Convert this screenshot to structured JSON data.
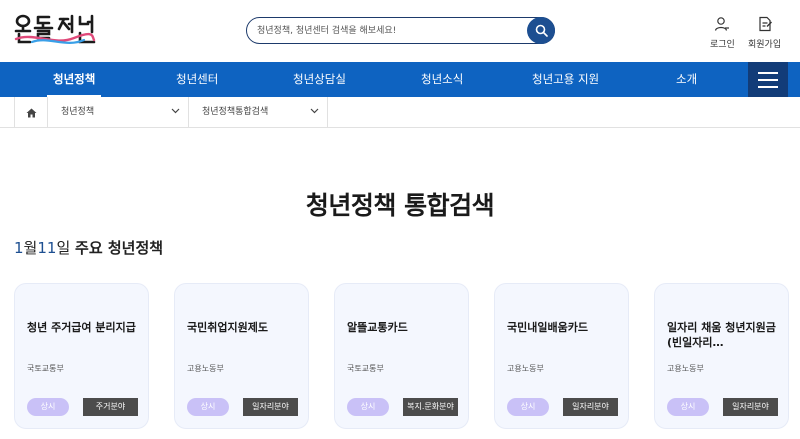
{
  "header": {
    "logo_alt": "온통청년",
    "search_placeholder": "청년정책, 청년센터 검색을 해보세요!",
    "login_label": "로그인",
    "join_label": "회원가입"
  },
  "nav": {
    "items": [
      "청년정책",
      "청년센터",
      "청년상담실",
      "청년소식",
      "청년고용 지원",
      "소개"
    ],
    "active_index": 0
  },
  "breadcrumb": {
    "level1": "청년정책",
    "level2": "청년정책통합검색"
  },
  "main": {
    "title": "청년정책 통합검색",
    "date_month": "1",
    "date_month_suffix": "월",
    "date_day": "11",
    "date_day_suffix": "일",
    "date_heading": "주요 청년정책"
  },
  "cards": [
    {
      "title": "청년 주거급여 분리지급",
      "org": "국토교통부",
      "period": "상시",
      "category": "주거분야"
    },
    {
      "title": "국민취업지원제도",
      "org": "고용노동부",
      "period": "상시",
      "category": "일자리분야"
    },
    {
      "title": "알뜰교통카드",
      "org": "국토교통부",
      "period": "상시",
      "category": "복지.문화분야"
    },
    {
      "title": "국민내일배움카드",
      "org": "고용노동부",
      "period": "상시",
      "category": "일자리분야"
    },
    {
      "title": "일자리 채움 청년지원금(빈일자리…",
      "org": "고용노동부",
      "period": "상시",
      "category": "일자리분야"
    }
  ],
  "colors": {
    "nav_blue": "#0e63c1",
    "menu_navy": "#123c78",
    "search_button": "#1d4f91",
    "period_tag": "#c9c1f7",
    "category_tag": "#4c4c4c",
    "card_bg": "#f4f7fe"
  },
  "icons": [
    "logo",
    "search-icon",
    "user-icon",
    "sign-up-icon",
    "home-icon",
    "chevron-down-icon",
    "hamburger-menu-icon"
  ]
}
